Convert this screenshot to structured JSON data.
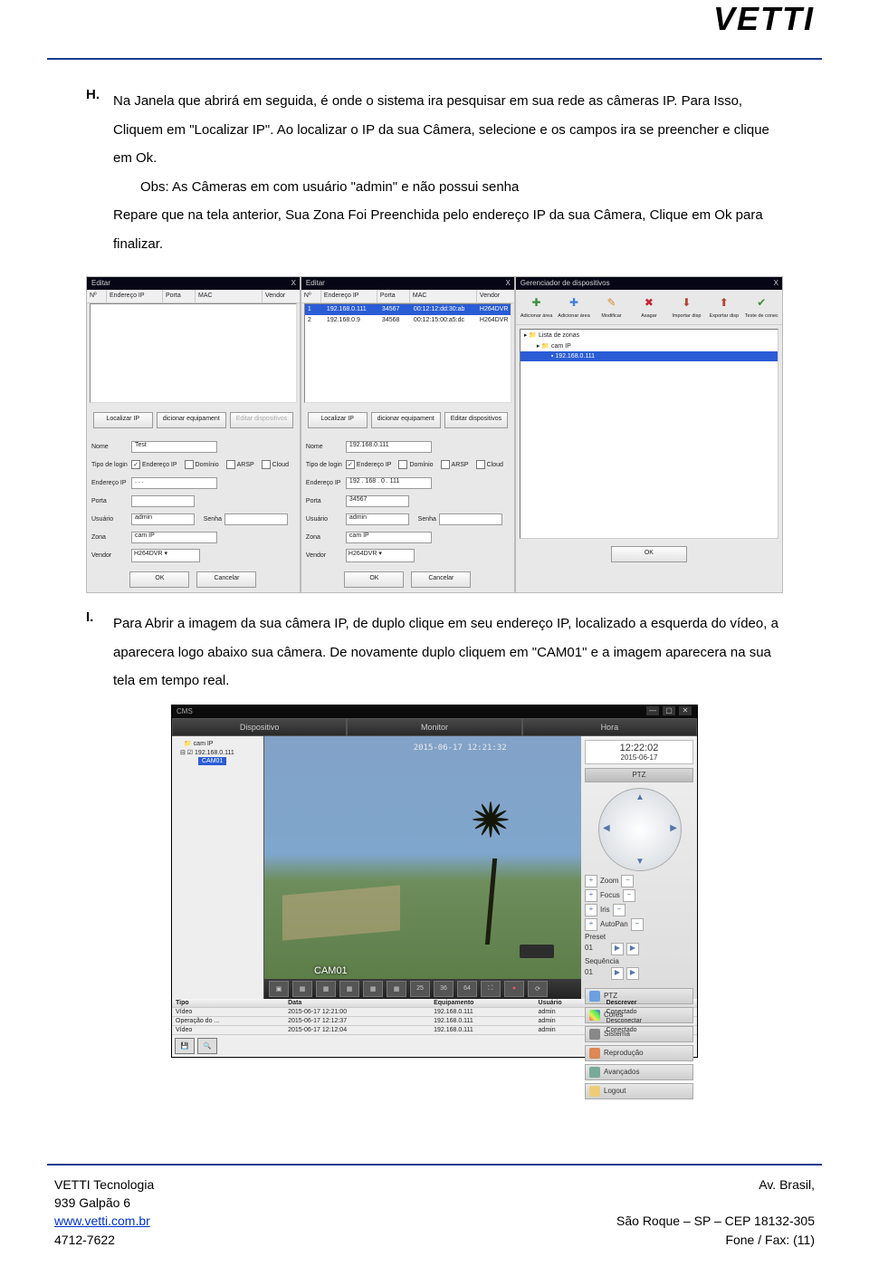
{
  "header": {
    "logo": "VETTI"
  },
  "list": {
    "H": {
      "marker": "H.",
      "p1": "Na Janela que abrirá em seguida, é onde o sistema ira pesquisar em sua rede as câmeras IP. Para Isso, Cliquem em \"Localizar IP\". Ao localizar o IP da sua Câmera, selecione e os campos ira se preencher e clique em Ok.",
      "p2": "Obs: As Câmeras em com usuário \"admin\" e não possui senha",
      "p3": "Repare que na tela anterior, Sua Zona Foi Preenchida pelo endereço IP da sua Câmera, Clique em Ok para finalizar."
    },
    "I": {
      "marker": "I.",
      "p1": "Para Abrir a imagem da sua câmera IP, de duplo clique em seu endereço IP, localizado a esquerda do vídeo, a aparecera logo abaixo sua câmera. De novamente duplo cliquem em \"CAM01\" e a imagem aparecera na sua tela em tempo real."
    }
  },
  "tableCols": {
    "n": "Nº",
    "ip": "Endereço IP",
    "port": "Porta",
    "mac": "MAC",
    "vendor": "Vendor"
  },
  "panel1": {
    "title": "Editar",
    "btn_locate": "Localizar IP",
    "btn_add": "dicionar equipament",
    "btn_edit": "Editar dispositivos",
    "lbl_name": "Nome",
    "v_name": "Test",
    "lbl_type": "Tipo de login",
    "chk1": "Endereço IP",
    "chk2": "Domínio",
    "chk3": "ARSP",
    "chk4": "Cloud",
    "lbl_ip": "Endereço IP",
    "v_ip": "  .     .     .",
    "lbl_port": "Porta",
    "v_port": "",
    "lbl_user": "Usuário",
    "v_user": "admin",
    "lbl_pass": "Senha",
    "lbl_zone": "Zona",
    "v_zone": "cam IP",
    "lbl_vendor": "Vendor",
    "v_vendor": "H264DVR",
    "btn_ok": "OK",
    "btn_cancel": "Cancelar"
  },
  "panel2": {
    "title": "Editar",
    "rows": [
      {
        "n": "1",
        "ip": "192.168.0.111",
        "port": "34567",
        "mac": "00:12:12:dd:30:ab",
        "vendor": "H264DVR"
      },
      {
        "n": "2",
        "ip": "192.168.0.9",
        "port": "34568",
        "mac": "00:12:15:00:a5:dc",
        "vendor": "H264DVR"
      }
    ],
    "btn_locate": "Localizar IP",
    "btn_add": "dicionar equipament",
    "btn_edit": "Editar dispositivos",
    "lbl_name": "Nome",
    "v_name": "192.168.0.111",
    "lbl_type": "Tipo de login",
    "chk1": "Endereço IP",
    "chk2": "Domínio",
    "chk3": "ARSP",
    "chk4": "Cloud",
    "lbl_ip": "Endereço IP",
    "v_ip": "192 . 168 .  0  . 111",
    "lbl_port": "Porta",
    "v_port": "34567",
    "lbl_user": "Usuário",
    "v_user": "admin",
    "lbl_pass": "Senha",
    "lbl_zone": "Zona",
    "v_zone": "cam IP",
    "lbl_vendor": "Vendor",
    "v_vendor": "H264DVR",
    "btn_ok": "OK",
    "btn_cancel": "Cancelar"
  },
  "panel3": {
    "title": "Gerenciador de dispositivos",
    "toolbar": [
      "Adicionar área",
      "Adicionar área",
      "Modificar",
      "Asagar",
      "Importar disp",
      "Exportar disp",
      "Teste de conec"
    ],
    "tree": {
      "root": "Lista de zonas",
      "sub": "cam IP",
      "leaf": "192.168.0.111"
    },
    "btn_ok": "OK"
  },
  "cms": {
    "title": "CMS",
    "tabs": {
      "device": "Dispositivo",
      "monitor": "Monitor",
      "time": "Hora"
    },
    "tree": {
      "root": "cam IP",
      "ip": "192.168.0.111",
      "cam": "CAM01"
    },
    "video_ts": "2015-06-17 12:21:32",
    "video_cam": "CAM01",
    "toolbar_nums": [
      "25",
      "36",
      "64"
    ],
    "clock": {
      "time": "12:22:02",
      "date": "2015-06-17"
    },
    "ptz_title": "PTZ",
    "ptz": {
      "zoom": "Zoom",
      "focus": "Focus",
      "iris": "Iris",
      "autopan": "AutoPan",
      "preset": "Preset",
      "seq": "Sequência",
      "sel": "01"
    },
    "side": {
      "ptz": "PTZ",
      "colors": "Cores",
      "system": "Sistema",
      "playback": "Reprodução",
      "advanced": "Avançados",
      "logout": "Logout"
    },
    "log": {
      "headers": {
        "type": "Tipo",
        "date": "Data",
        "equip": "Equipamento",
        "user": "Usuário",
        "desc": "Descrever"
      },
      "rows": [
        {
          "type": "Vídeo",
          "date": "2015-06-17 12:21:00",
          "equip": "192.168.0.111",
          "user": "admin",
          "desc": "Conectado"
        },
        {
          "type": "Operação do ...",
          "date": "2015-06-17 12:12:37",
          "equip": "192.168.0.111",
          "user": "admin",
          "desc": "Desconectar"
        },
        {
          "type": "Vídeo",
          "date": "2015-06-17 12:12:04",
          "equip": "192.168.0.111",
          "user": "admin",
          "desc": "Conectado"
        }
      ]
    }
  },
  "footer": {
    "company": "VETTI Tecnologia",
    "addr_left": "939 Galpão 6",
    "url": "www.vetti.com.br",
    "phone_code": "4712-7622",
    "addr_right1": "Av. Brasil,",
    "addr_right2": "São Roque – SP – CEP 18132-305",
    "phone": "Fone / Fax: (11)"
  }
}
